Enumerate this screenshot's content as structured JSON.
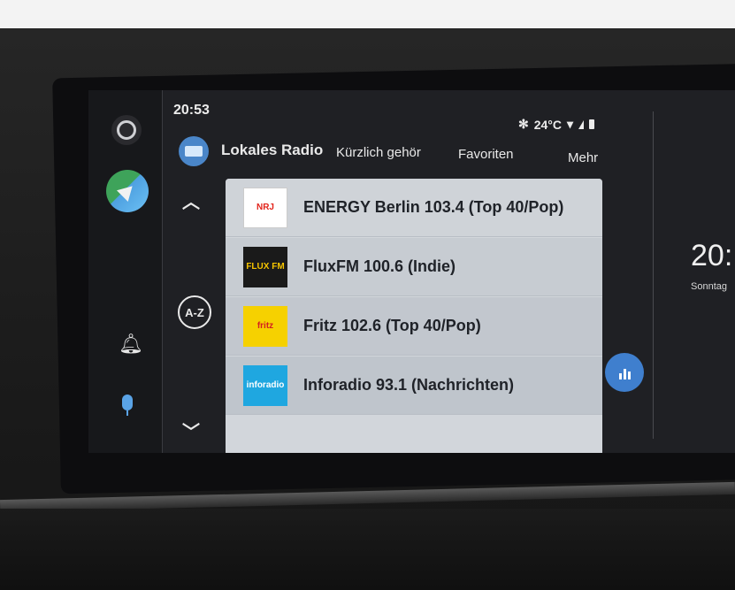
{
  "status": {
    "time": "20:53",
    "temperature": "24°C"
  },
  "app": {
    "title": "Lokales Radio"
  },
  "tabs": [
    {
      "label": "Kürzlich gehör"
    },
    {
      "label": "Favoriten"
    },
    {
      "label": "Mehr"
    }
  ],
  "sort_button": {
    "label": "A-Z"
  },
  "stations": [
    {
      "name": "ENERGY Berlin 103.4 (Top 40/Pop)",
      "logo_text": "NRJ"
    },
    {
      "name": "FluxFM 100.6 (Indie)",
      "logo_text": "FLUX FM"
    },
    {
      "name": "Fritz 102.6 (Top 40/Pop)",
      "logo_text": "fritz"
    },
    {
      "name": "Inforadio 93.1 (Nachrichten)",
      "logo_text": "inforadio"
    }
  ],
  "side_panel": {
    "clock": "20:",
    "day": "Sonntag"
  },
  "icons": {
    "rail": [
      "home-circle-icon",
      "maps-icon",
      "bell-icon",
      "microphone-icon"
    ],
    "status": [
      "sun-icon",
      "wifi-icon",
      "signal-icon",
      "battery-icon"
    ],
    "list": [
      "chevron-up-icon",
      "chevron-down-icon",
      "equalizer-icon"
    ]
  },
  "colors": {
    "accent": "#3f7fce",
    "screen_bg": "#1f2024",
    "list_bg": "#d2d6db"
  }
}
